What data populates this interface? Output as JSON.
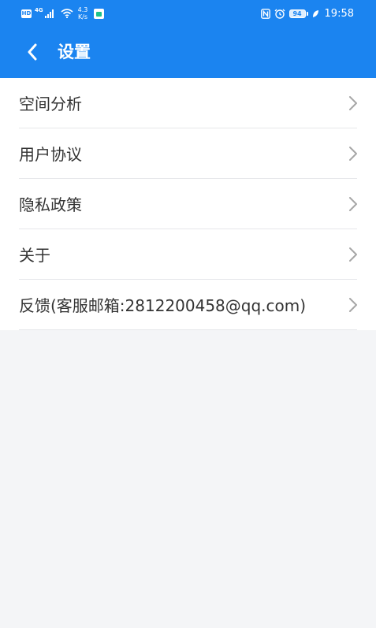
{
  "status_bar": {
    "hd_label": "HD",
    "network_type": "4G",
    "speed_value": "4.3",
    "speed_unit": "K/s",
    "battery_level": "94",
    "time": "19:58"
  },
  "header": {
    "title": "设置",
    "back_icon": "chevron-left-icon"
  },
  "menu": {
    "items": [
      {
        "label": "空间分析"
      },
      {
        "label": "用户协议"
      },
      {
        "label": "隐私政策"
      },
      {
        "label": "关于"
      },
      {
        "label": "反馈(客服邮箱:2812200458@qq.com)"
      }
    ],
    "chevron_icon": "chevron-right-icon"
  },
  "colors": {
    "header_bg": "#1b84f0",
    "page_bg": "#f4f5f7",
    "list_bg": "#ffffff",
    "divider": "#e6e7ea",
    "text": "#333333",
    "chevron": "#a6a6a6"
  }
}
